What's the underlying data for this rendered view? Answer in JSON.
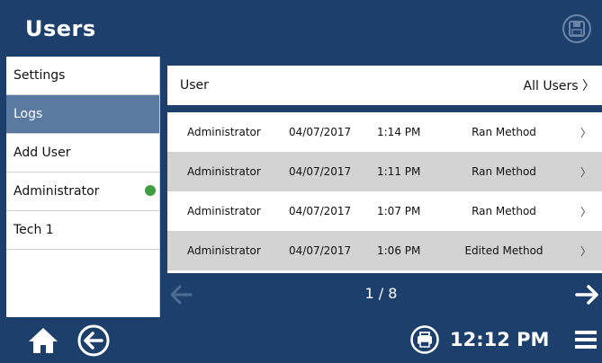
{
  "header": {
    "title": "Users"
  },
  "sidebar": {
    "items": [
      {
        "label": "Settings"
      },
      {
        "label": "Logs"
      },
      {
        "label": "Add User"
      },
      {
        "label": "Administrator"
      },
      {
        "label": "Tech 1"
      }
    ]
  },
  "filter": {
    "label": "User",
    "value": "All Users 〉"
  },
  "table": {
    "rows": [
      {
        "user": "Administrator",
        "date": "04/07/2017",
        "time": "1:14 PM",
        "action": "Ran Method",
        "chevron": "〉"
      },
      {
        "user": "Administrator",
        "date": "04/07/2017",
        "time": "1:11 PM",
        "action": "Ran Method",
        "chevron": "〉"
      },
      {
        "user": "Administrator",
        "date": "04/07/2017",
        "time": "1:07 PM",
        "action": "Ran Method",
        "chevron": "〉"
      },
      {
        "user": "Administrator",
        "date": "04/07/2017",
        "time": "1:06 PM",
        "action": "Edited Method",
        "chevron": "〉"
      }
    ]
  },
  "pager": {
    "text": "1 / 8"
  },
  "footer": {
    "clock": "12:12 PM"
  },
  "colors": {
    "navy": "#1c3f6b",
    "active": "#5a7aa1",
    "status_green": "#3f9e3f"
  }
}
